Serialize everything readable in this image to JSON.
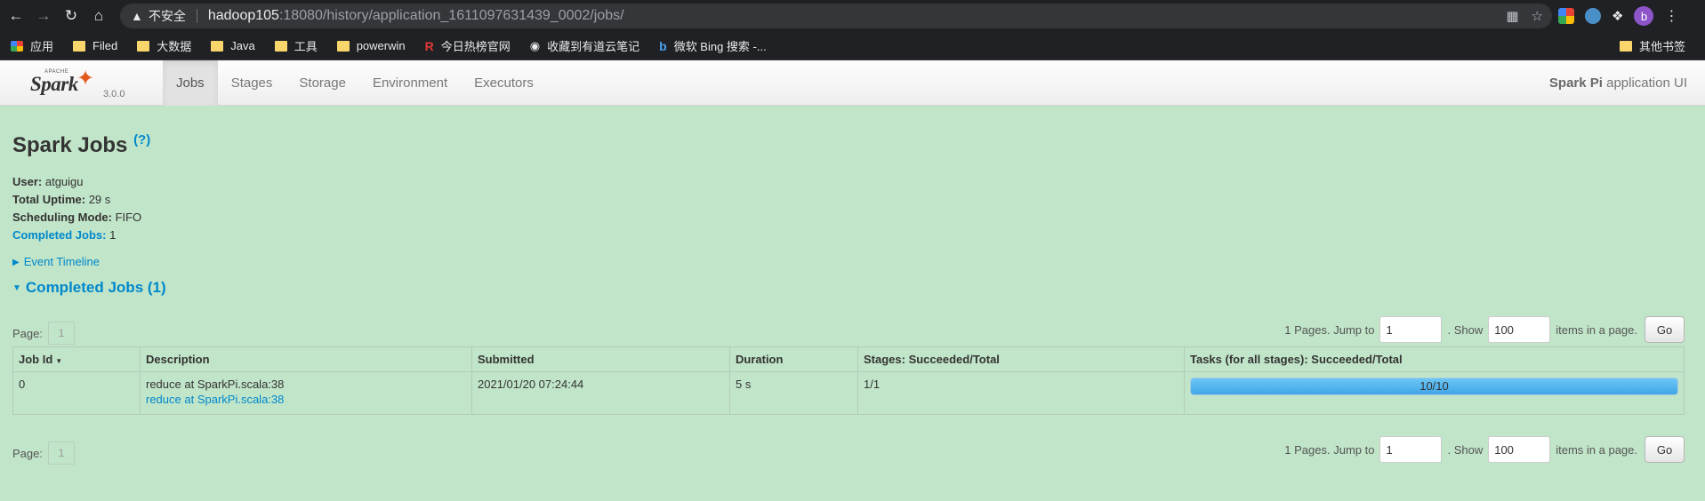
{
  "browser": {
    "insecure_label": "不安全",
    "url_host": "hadoop105",
    "url_rest": ":18080/history/application_1611097631439_0002/jobs/",
    "bookmarks": [
      "应用",
      "Filed",
      "大数据",
      "Java",
      "工具",
      "powerwin",
      "今日热榜官网",
      "收藏到有道云笔记",
      "微软 Bing 搜索 -..."
    ],
    "other_bookmarks": "其他书签",
    "avatar_letter": "b"
  },
  "spark": {
    "version": "3.0.0",
    "apache": "APACHE",
    "logo_text": "Spark",
    "tabs": [
      "Jobs",
      "Stages",
      "Storage",
      "Environment",
      "Executors"
    ],
    "active_tab": "Jobs",
    "app_name": "Spark Pi",
    "app_suffix": " application UI"
  },
  "page": {
    "title": "Spark Jobs",
    "help": "(?)",
    "user_label": "User:",
    "user": " atguigu",
    "uptime_label": "Total Uptime:",
    "uptime": " 29 s",
    "mode_label": "Scheduling Mode:",
    "mode": " FIFO",
    "completed_label": "Completed Jobs:",
    "completed": " 1",
    "event_timeline": "Event Timeline",
    "section_title": "Completed Jobs (1)"
  },
  "pager": {
    "page_label": "Page:",
    "current_page": "1",
    "pages_text": "1 Pages. Jump to",
    "jump_value": "1",
    "show_text": ". Show",
    "show_value": "100",
    "items_text": "items in a page.",
    "go": "Go"
  },
  "table": {
    "headers": [
      "Job Id",
      "Description",
      "Submitted",
      "Duration",
      "Stages: Succeeded/Total",
      "Tasks (for all stages): Succeeded/Total"
    ],
    "rows": [
      {
        "job_id": "0",
        "description": "reduce at SparkPi.scala:38",
        "description_link": "reduce at SparkPi.scala:38",
        "submitted": "2021/01/20 07:24:44",
        "duration": "5 s",
        "stages": "1/1",
        "tasks": "10/10",
        "tasks_fraction": 1.0
      }
    ]
  },
  "colors": {
    "background": "#c1e5c9",
    "link": "#0088cc",
    "progress": "#40a6e8"
  }
}
